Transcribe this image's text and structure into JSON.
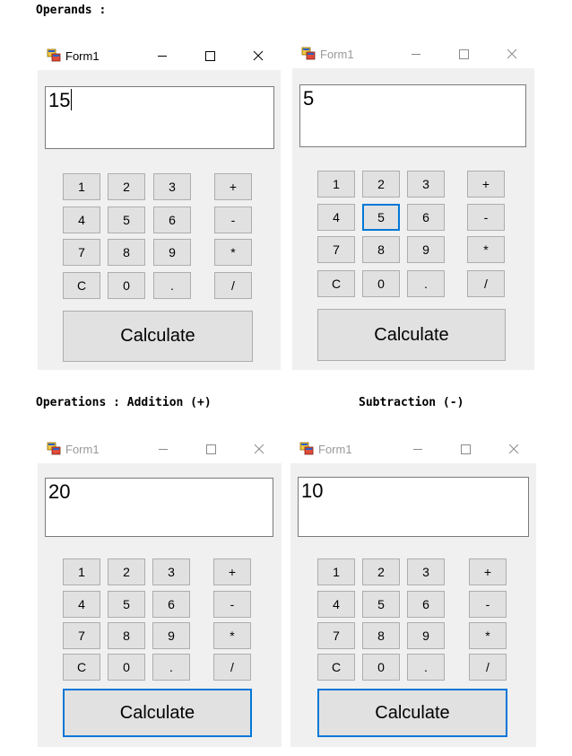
{
  "captions": {
    "operands": "Operands :",
    "operations": "Operations : Addition (+)",
    "subtraction": "Subtraction (-)"
  },
  "colors": {
    "focus_border": "#0078d7",
    "client_bg": "#f0f0f0",
    "button_bg": "#e1e1e1",
    "button_border": "#adadad"
  },
  "keypad": [
    [
      "1",
      "2",
      "3",
      "+"
    ],
    [
      "4",
      "5",
      "6",
      "-"
    ],
    [
      "7",
      "8",
      "9",
      "*"
    ],
    [
      "C",
      "0",
      ".",
      "/"
    ]
  ],
  "windows": [
    {
      "title": "Form1",
      "display_value": "15",
      "calculate_label": "Calculate",
      "state": "active"
    },
    {
      "title": "Form1",
      "display_value": "5",
      "calculate_label": "Calculate",
      "state": "inactive",
      "focused_key": "5"
    },
    {
      "title": "Form1",
      "display_value": "20",
      "calculate_label": "Calculate",
      "state": "inactive",
      "focused_key": "Calculate"
    },
    {
      "title": "Form1",
      "display_value": "10",
      "calculate_label": "Calculate",
      "state": "inactive",
      "focused_key": "Calculate"
    }
  ]
}
